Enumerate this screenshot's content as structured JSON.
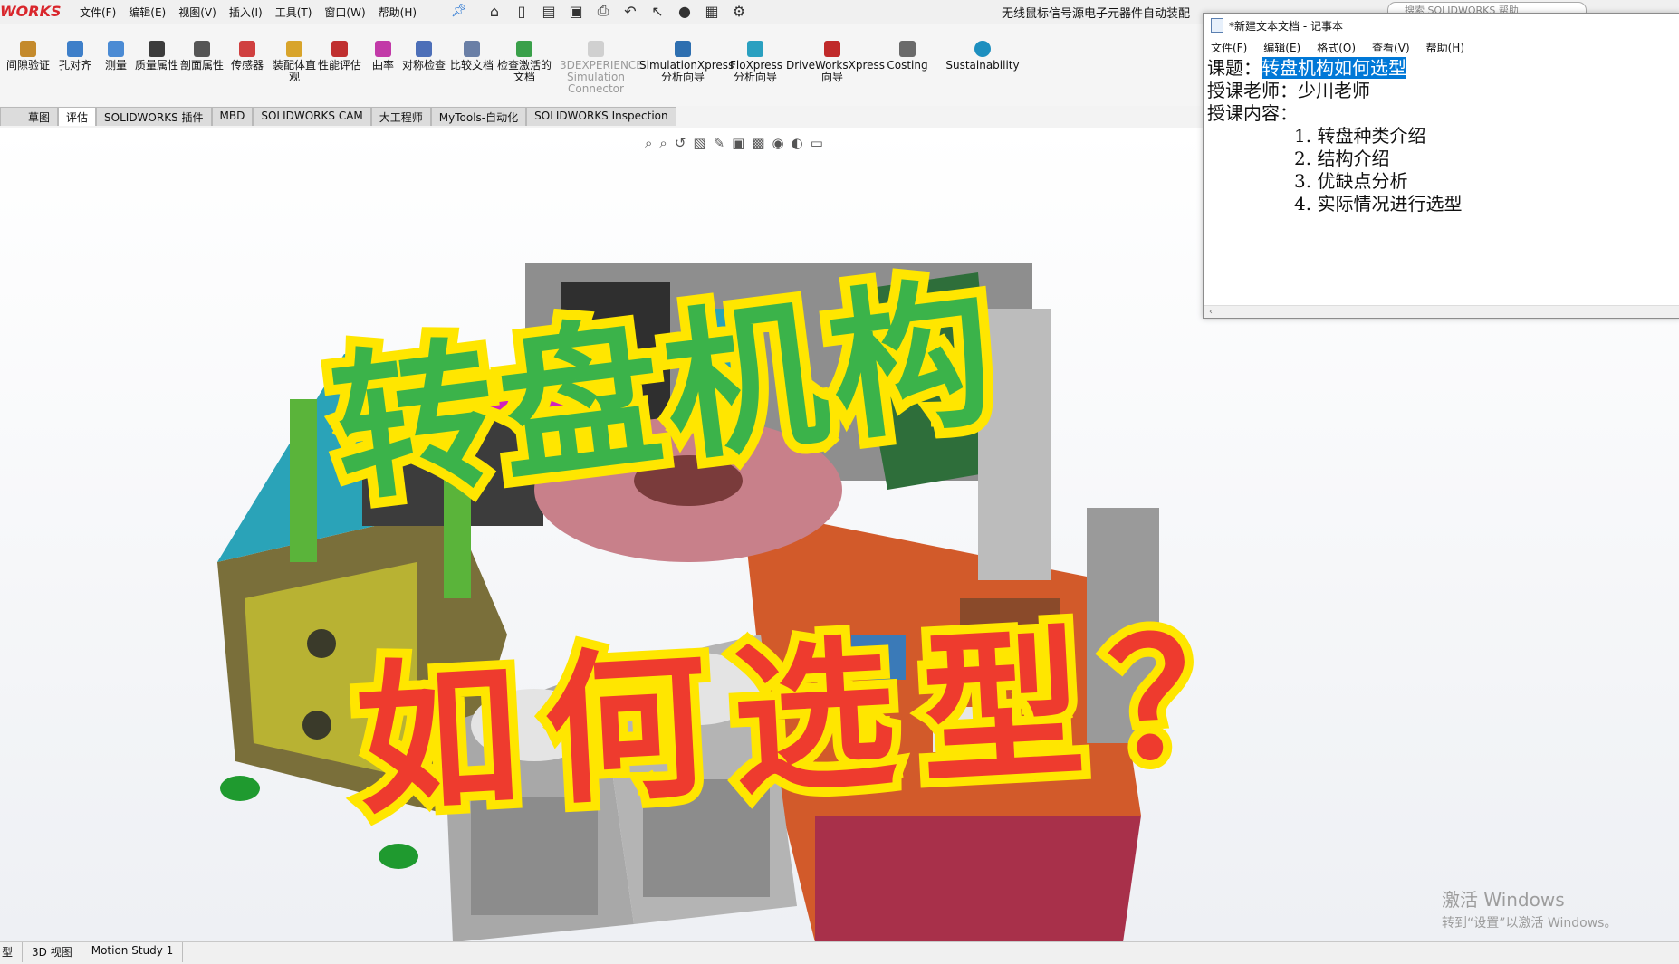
{
  "app": {
    "brand": "WORKS"
  },
  "menu": [
    "文件(F)",
    "编辑(E)",
    "视图(V)",
    "插入(I)",
    "工具(T)",
    "窗口(W)",
    "帮助(H)"
  ],
  "document_title": "无线鼠标信号源电子元器件自动装配",
  "search_placeholder": "搜索 SOLIDWORKS 帮助",
  "ribbon": [
    {
      "label": "间隙验证",
      "color": "#c48a2c"
    },
    {
      "label": "孔对齐",
      "color": "#3e7fc9"
    },
    {
      "label": "测量",
      "color": "#4b8bd4"
    },
    {
      "label": "质量属性",
      "color": "#3c3c3c"
    },
    {
      "label": "剖面属性",
      "color": "#555555"
    },
    {
      "label": "传感器",
      "color": "#d04040"
    },
    {
      "label": "装配体直观",
      "color": "#d8a42b"
    },
    {
      "label": "性能评估",
      "color": "#c03030"
    },
    {
      "label": "曲率",
      "color": "#c23aa8"
    },
    {
      "label": "对称检查",
      "color": "#4d6fb8"
    },
    {
      "label": "比较文档",
      "color": "#6a7fa6"
    },
    {
      "label": "检查激活的文档",
      "color": "#3aa04a"
    },
    {
      "label": "3DEXPERIENCE Simulation Connector",
      "color": "#b0b0b0"
    },
    {
      "label": "SimulationXpress 分析向导",
      "color": "#2e6fb0"
    },
    {
      "label": "FloXpress 分析向导",
      "color": "#2aa0c0"
    },
    {
      "label": "DriveWorksXpress 向导",
      "color": "#c02a2a"
    },
    {
      "label": "Costing",
      "color": "#6a6a6a"
    },
    {
      "label": "Sustainability",
      "color": "#1d8fbf"
    }
  ],
  "tabs": [
    "草图",
    "评估",
    "SOLIDWORKS 插件",
    "MBD",
    "SOLIDWORKS CAM",
    "大工程师",
    "MyTools-自动化",
    "SOLIDWORKS Inspection"
  ],
  "active_tab_index": 1,
  "overlay": {
    "title_line1": "转盘机构",
    "title_line2": "如何选型？",
    "line1_color": "#3bb34a",
    "line2_color": "#ee3b2e",
    "outline_color": "#ffe600"
  },
  "watermark": {
    "line1": "激活 Windows",
    "line2": "转到“设置”以激活 Windows。"
  },
  "status_tabs": [
    "型",
    "3D 视图",
    "Motion Study 1"
  ],
  "notepad": {
    "title": "*新建文本文档 - 记事本",
    "menu": [
      "文件(F)",
      "编辑(E)",
      "格式(O)",
      "查看(V)",
      "帮助(H)"
    ],
    "topic_label": "课题：",
    "topic_value": "转盘机构如何选型",
    "teacher_label": "授课老师：",
    "teacher_value": "少川老师",
    "content_label": "授课内容：",
    "items": [
      "1. 转盘种类介绍",
      "2. 结构介绍",
      "3. 优缺点分析",
      "4. 实际情况进行选型"
    ]
  }
}
